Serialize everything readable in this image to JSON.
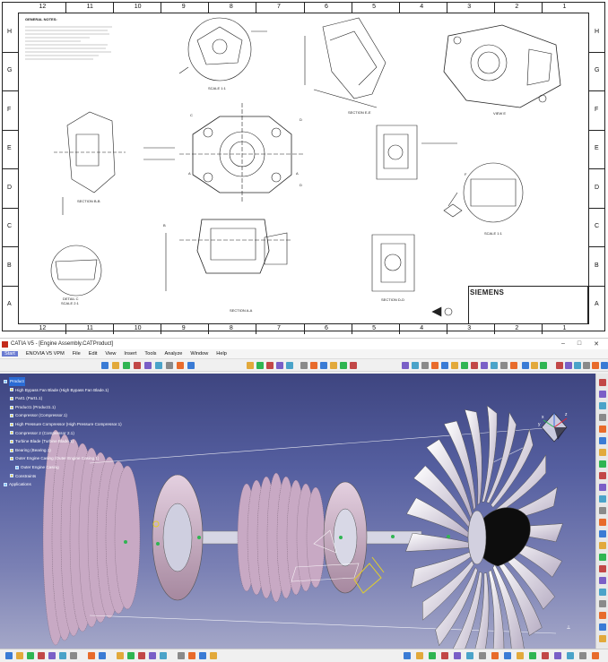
{
  "sheet": {
    "columns": [
      "12",
      "11",
      "10",
      "9",
      "8",
      "7",
      "6",
      "5",
      "4",
      "3",
      "2",
      "1"
    ],
    "rows": [
      "H",
      "G",
      "F",
      "E",
      "D",
      "C",
      "B",
      "A"
    ],
    "general_notes_title": "GENERAL NOTES:",
    "views": {
      "detail_a_scale": "SCALE 1:1",
      "section_e_e": "SECTION E-E",
      "view_e": "VIEW E",
      "section_b_b": "SECTION B-B",
      "detail_c_label": "DETAIL C",
      "detail_c_scale": "SCALE 2:1",
      "section_a_a": "SECTION A-A",
      "section_d_d": "SECTION D-D",
      "detail_f_scale": "SCALE 1:1"
    },
    "callouts": [
      "A",
      "B",
      "C",
      "D",
      "F"
    ],
    "title_block_company": "SIEMENS"
  },
  "catia": {
    "window_title": "CATIA V5 - [Engine Assembly.CATProduct]",
    "window_controls": [
      "–",
      "□",
      "✕"
    ],
    "menu": [
      "Start",
      "ENOVIA V5 VPM",
      "File",
      "Edit",
      "View",
      "Insert",
      "Tools",
      "Analyze",
      "Window",
      "Help"
    ],
    "tree": [
      {
        "label": "Product",
        "level": 0
      },
      {
        "label": "High Bypass Fan Blade (High Bypass Fan Blade.1)",
        "level": 1
      },
      {
        "label": "Part1 (Part1.1)",
        "level": 1
      },
      {
        "label": "Product1 (Product1.1)",
        "level": 1
      },
      {
        "label": "Compressor (Compressor.1)",
        "level": 1
      },
      {
        "label": "High Pressure Compressor (High Pressure Compressor.1)",
        "level": 1
      },
      {
        "label": "Compressor 2 (Compressor 2.1)",
        "level": 1
      },
      {
        "label": "Turbine Blade (Turbine Blade.1)",
        "level": 1
      },
      {
        "label": "Bearing (Bearing.1)",
        "level": 1
      },
      {
        "label": "Outer Engine Casing (Outer Engine Casing.1)",
        "level": 1
      },
      {
        "label": "Outer Engine Casing",
        "level": 2
      },
      {
        "label": "Constraints",
        "level": 1
      },
      {
        "label": "Applications",
        "level": 0
      }
    ],
    "compass_axes": [
      "x",
      "y",
      "z"
    ],
    "colors": {
      "viewport_top": "#3e4580",
      "viewport_bottom": "#a4a7c8",
      "fan_blade": "#d5c7dd",
      "compressor_disk": "#c8a9c4",
      "nose_cone": "#111111",
      "tree_highlight": "#2a6bd4"
    },
    "icons": [
      "new-icon",
      "open-icon",
      "save-icon",
      "print-icon",
      "undo-icon",
      "redo-icon",
      "help-icon",
      "formula-icon",
      "fly-mode-icon",
      "pan-icon",
      "rotate-icon",
      "zoom-in-icon",
      "zoom-out-icon",
      "normal-view-icon",
      "iso-view-icon",
      "shading-icon",
      "hide-show-icon",
      "swap-icon"
    ]
  }
}
